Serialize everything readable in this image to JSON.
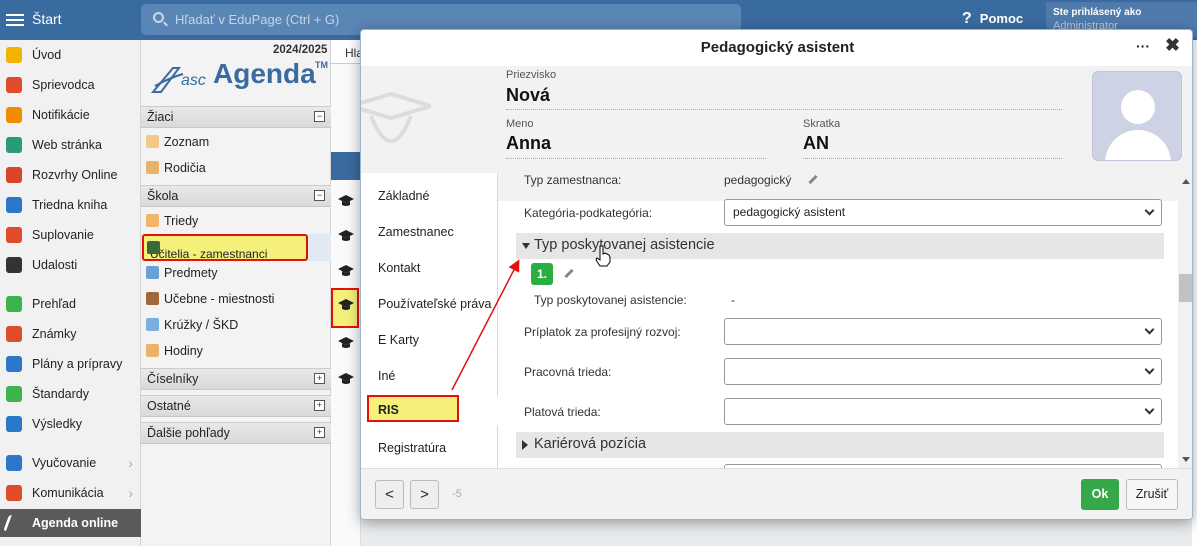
{
  "topbar": {
    "start_label": "Štart",
    "search_placeholder": "Hľadať v EduPage (Ctrl + G)",
    "help_icon": "?",
    "help_label": "Pomoc",
    "login_label": "Ste prihlásený ako",
    "login_role": "Administrator"
  },
  "leftnav": {
    "items": [
      {
        "label": "Úvod",
        "icon": "star-icon",
        "color": "#f0b400"
      },
      {
        "label": "Sprievodca",
        "icon": "wand-icon",
        "color": "#e04b2b"
      },
      {
        "label": "Notifikácie",
        "icon": "envelope-icon",
        "color": "#f08c00"
      },
      {
        "label": "Web stránka",
        "icon": "house-icon",
        "color": "#2a9a7a"
      },
      {
        "label": "Rozvrhy Online",
        "icon": "timetable-icon",
        "color": "#d9452b"
      },
      {
        "label": "Triedna kniha",
        "icon": "book-icon",
        "color": "#2b78c8"
      },
      {
        "label": "Suplovanie",
        "icon": "substitute-icon",
        "color": "#e04b2b"
      },
      {
        "label": "Udalosti",
        "icon": "calendar-icon",
        "color": "#333333"
      },
      {
        "label": "Prehľad",
        "icon": "check-circle-icon",
        "color": "#3cb44b"
      },
      {
        "label": "Známky",
        "icon": "grades-icon",
        "color": "#e04b2b"
      },
      {
        "label": "Plány a prípravy",
        "icon": "briefcase-icon",
        "color": "#2b78c8"
      },
      {
        "label": "Štandardy",
        "icon": "shield-check-icon",
        "color": "#3cb44b"
      },
      {
        "label": "Výsledky",
        "icon": "bar-chart-icon",
        "color": "#2b78c8"
      },
      {
        "label": "Vyučovanie",
        "icon": "teaching-icon",
        "color": "#2b78c8"
      },
      {
        "label": "Komunikácia",
        "icon": "chat-icon",
        "color": "#e04b2b"
      },
      {
        "label": "Agenda online",
        "icon": "agenda-icon",
        "color": "#ffffff"
      }
    ]
  },
  "agenda": {
    "year": "2024/2025",
    "logo_asc": "asc",
    "logo_agenda": "Agenda",
    "logo_tm": "TM",
    "sections": [
      {
        "label": "Žiaci",
        "toggle": "−"
      },
      {
        "label": "Škola",
        "toggle": "−"
      },
      {
        "label": "Číselníky",
        "toggle": "+"
      },
      {
        "label": "Ostatné",
        "toggle": "+"
      },
      {
        "label": "Ďalšie pohľady",
        "toggle": "+"
      }
    ],
    "items": [
      {
        "label": "Zoznam",
        "icon": "student-icon"
      },
      {
        "label": "Rodičia",
        "icon": "parents-icon"
      },
      {
        "label": "Triedy",
        "icon": "class-icon"
      },
      {
        "label": "Učitelia - zamestnanci",
        "icon": "teacher-cap-icon"
      },
      {
        "label": "Predmety",
        "icon": "subject-icon"
      },
      {
        "label": "Učebne - miestnosti",
        "icon": "door-icon"
      },
      {
        "label": "Krúžky / ŠKD",
        "icon": "puzzle-icon"
      },
      {
        "label": "Hodiny",
        "icon": "lessons-icon"
      }
    ]
  },
  "mid": {
    "header": "Hla"
  },
  "modal": {
    "title": "Pedagogický asistent",
    "more": "···",
    "close": "✖",
    "surname_label": "Priezvisko",
    "surname": "Nová",
    "name_label": "Meno",
    "name": "Anna",
    "abbr_label": "Skratka",
    "abbr": "AN",
    "tabs": [
      "Základné",
      "Zamestnanec",
      "Kontakt",
      "Používateľské práva",
      "E Karty",
      "Iné",
      "RIS",
      "Registratúra"
    ],
    "fields": {
      "typ_label": "Typ zamestnanca:",
      "typ_value": "pedagogický",
      "kategoria_label": "Kategória-podkategória:",
      "kategoria_value": "pedagogický asistent",
      "group1": "Typ poskytovanej asistencie",
      "badge": "1.",
      "typ_asist_label": "Typ poskytovanej asistencie:",
      "typ_asist_value": "-",
      "priplatok_label": "Príplatok za profesijný rozvoj:",
      "priplatok_value": "",
      "pracovna_label": "Pracovná trieda:",
      "pracovna_value": "",
      "platova_label": "Platová trieda:",
      "platova_value": "",
      "group2": "Kariérová pozícia"
    },
    "footer": {
      "prev": "<",
      "next": ">",
      "page": "-5",
      "ok": "Ok",
      "cancel": "Zrušiť"
    }
  },
  "colors": {
    "topbar": "#3a6ba0",
    "highlight": "#f4f07a",
    "annotation_red": "#e31010",
    "ok_green": "#36a84a",
    "badge_green": "#27b040"
  }
}
